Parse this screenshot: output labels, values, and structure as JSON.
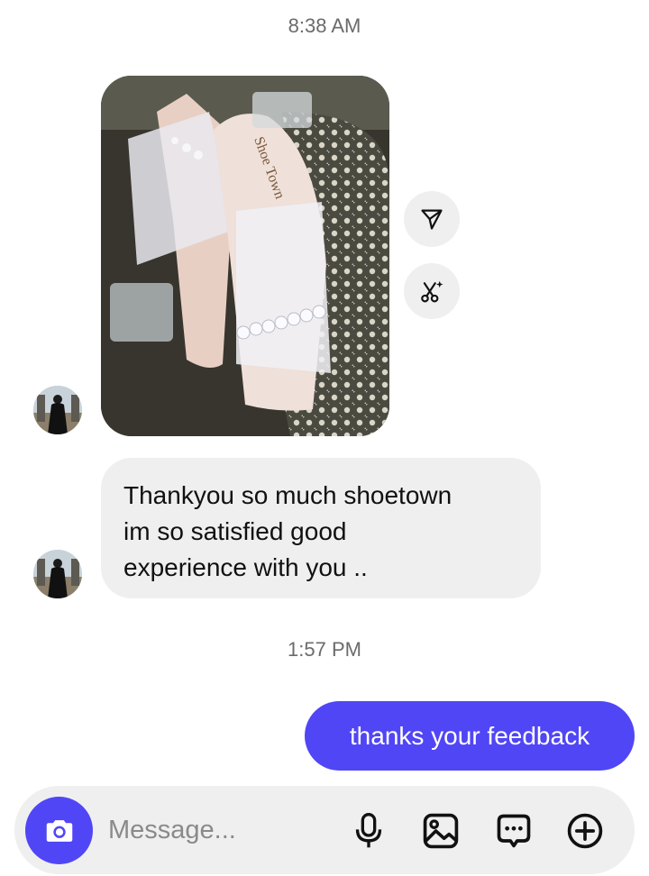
{
  "thread": {
    "timestamp_1": "8:38 AM",
    "timestamp_2": "1:57 PM"
  },
  "photo": {
    "brand_text": "Shoe Town"
  },
  "incoming_message": {
    "lines": [
      "Thankyou so much shoetown",
      "im so satisfied good",
      "experience with you .."
    ]
  },
  "outgoing_message": {
    "text": "thanks your feedback"
  },
  "composer": {
    "placeholder": "Message..."
  },
  "colors": {
    "accent": "#5046f5",
    "bubble_in": "#efefef",
    "timestamp": "#6b6b6b"
  },
  "icons": {
    "share": "share-icon",
    "edit": "scissors-sparkle-icon",
    "camera": "camera-icon",
    "mic": "microphone-icon",
    "gallery": "image-icon",
    "sticker": "sticker-icon",
    "plus": "add-circle-icon"
  }
}
